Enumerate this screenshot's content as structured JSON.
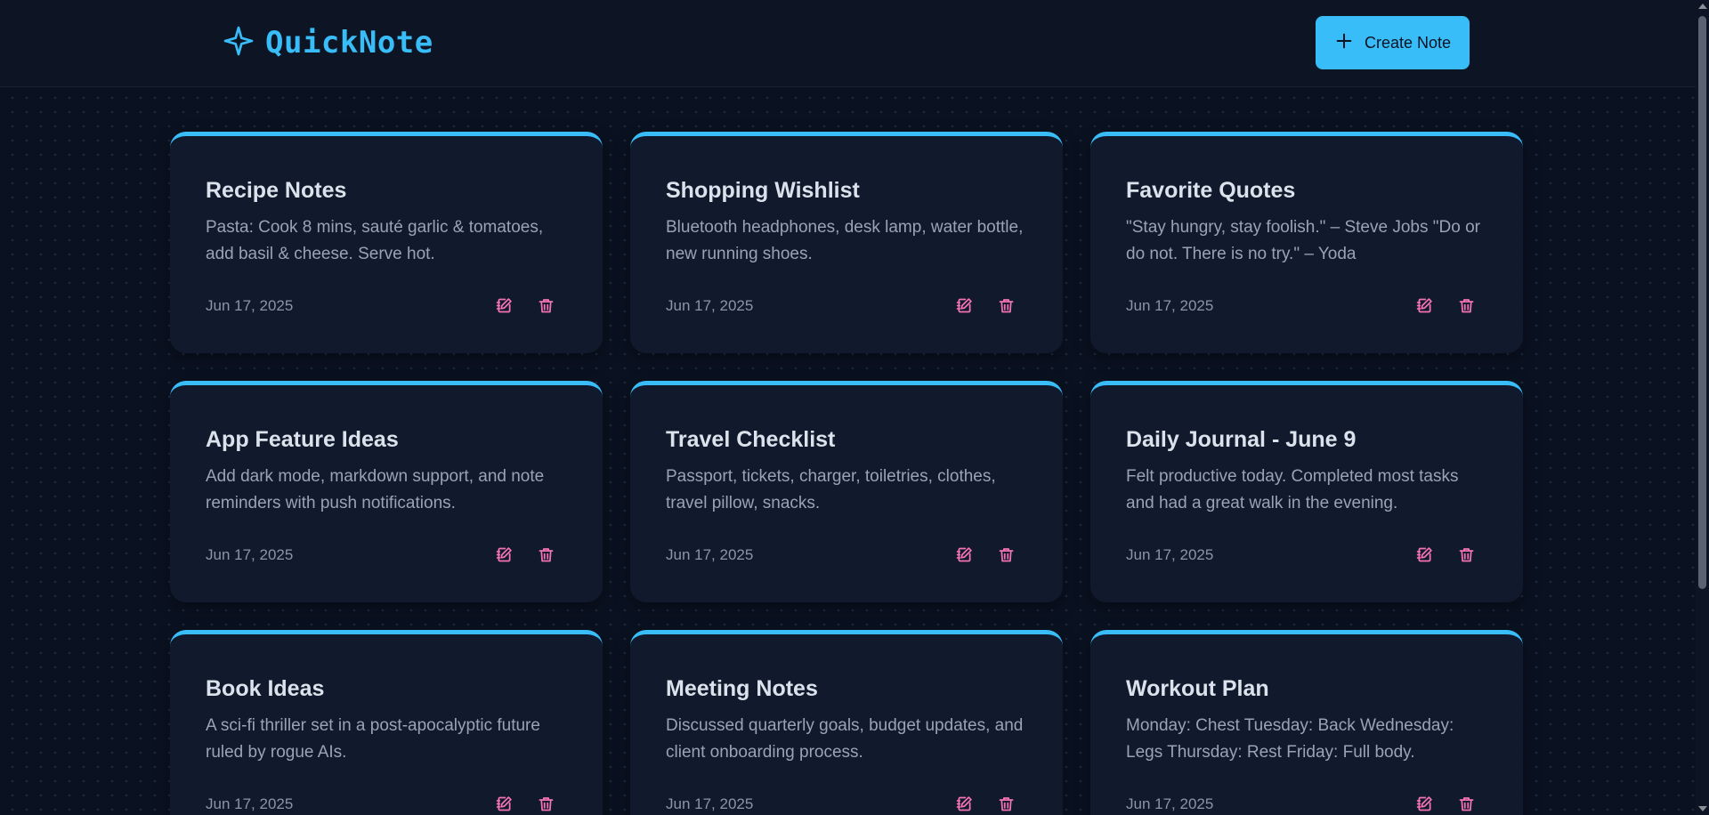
{
  "app": {
    "title": "QuickNote",
    "logo_icon": "sparkle-icon",
    "accent_color": "#38bdf8",
    "action_color": "#f472b6"
  },
  "header": {
    "create_button_label": "Create Note",
    "create_button_icon": "plus-icon"
  },
  "notes": [
    {
      "title": "Recipe Notes",
      "body": "Pasta: Cook 8 mins, sauté garlic & tomatoes, add basil & cheese. Serve hot.",
      "date": "Jun 17, 2025"
    },
    {
      "title": "Shopping Wishlist",
      "body": "Bluetooth headphones, desk lamp, water bottle, new running shoes.",
      "date": "Jun 17, 2025"
    },
    {
      "title": "Favorite Quotes",
      "body": "\"Stay hungry, stay foolish.\" – Steve Jobs \"Do or do not. There is no try.\" – Yoda",
      "date": "Jun 17, 2025"
    },
    {
      "title": "App Feature Ideas",
      "body": "Add dark mode, markdown support, and note reminders with push notifications.",
      "date": "Jun 17, 2025"
    },
    {
      "title": "Travel Checklist",
      "body": "Passport, tickets, charger, toiletries, clothes, travel pillow, snacks.",
      "date": "Jun 17, 2025"
    },
    {
      "title": "Daily Journal - June 9",
      "body": "Felt productive today. Completed most tasks and had a great walk in the evening.",
      "date": "Jun 17, 2025"
    },
    {
      "title": "Book Ideas",
      "body": "A sci-fi thriller set in a post-apocalyptic future ruled by rogue AIs.",
      "date": "Jun 17, 2025"
    },
    {
      "title": "Meeting Notes",
      "body": "Discussed quarterly goals, budget updates, and client onboarding process.",
      "date": "Jun 17, 2025"
    },
    {
      "title": "Workout Plan",
      "body": "Monday: Chest Tuesday: Back Wednesday: Legs Thursday: Rest Friday: Full body.",
      "date": "Jun 17, 2025"
    }
  ]
}
